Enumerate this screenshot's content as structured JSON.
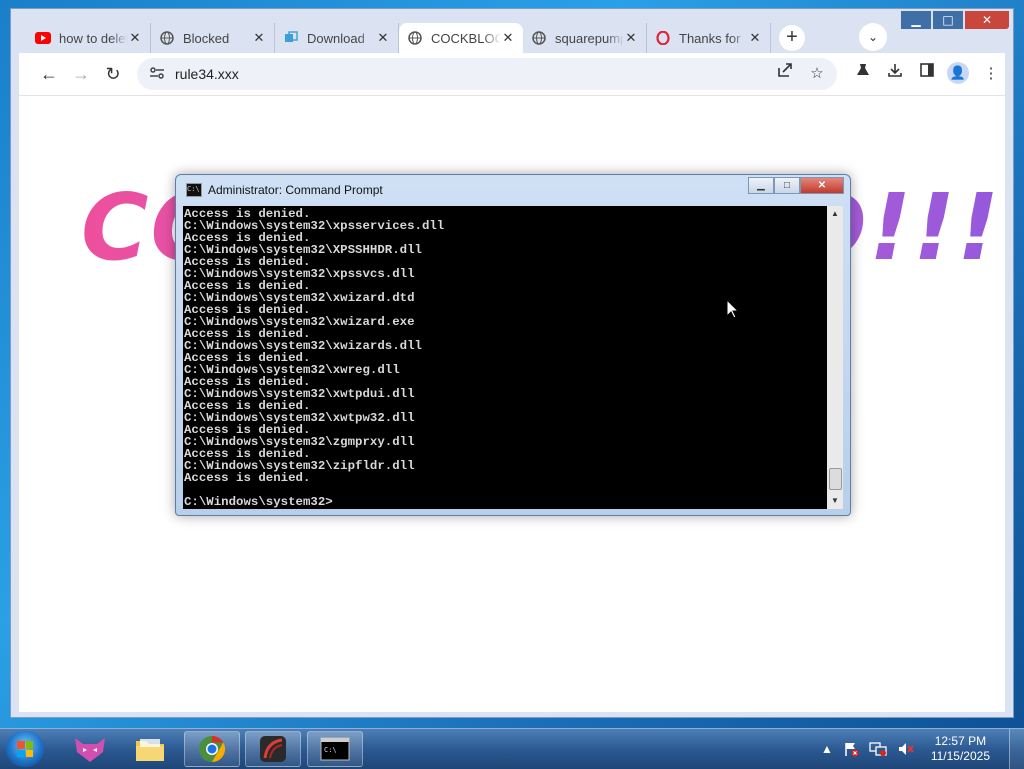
{
  "browser": {
    "tabs": [
      {
        "label": "how to delete",
        "icon": "youtube-icon",
        "active": false
      },
      {
        "label": "Blocked",
        "icon": "globe-icon",
        "active": false
      },
      {
        "label": "Download",
        "icon": "download-site-icon",
        "active": false
      },
      {
        "label": "COCKBLOCKED",
        "icon": "globe-icon",
        "active": true
      },
      {
        "label": "squarepump",
        "icon": "globe-icon",
        "active": false
      },
      {
        "label": "Thanks for",
        "icon": "opera-icon",
        "active": false
      }
    ],
    "address": {
      "url": "rule34.xxx"
    },
    "controls": {
      "back": "←",
      "forward": "→",
      "reload": "↻",
      "new_tab": "+",
      "tab_search": "⌄",
      "minimize": "▁",
      "maximize": "□",
      "close": "✕"
    }
  },
  "page": {
    "headline": "COCKBLOCKED!!!!!"
  },
  "cmd": {
    "title": "Administrator: Command Prompt",
    "icon_text": "C:\\",
    "lines": [
      "Access is denied.",
      "C:\\Windows\\system32\\xpsservices.dll",
      "Access is denied.",
      "C:\\Windows\\system32\\XPSSHHDR.dll",
      "Access is denied.",
      "C:\\Windows\\system32\\xpssvcs.dll",
      "Access is denied.",
      "C:\\Windows\\system32\\xwizard.dtd",
      "Access is denied.",
      "C:\\Windows\\system32\\xwizard.exe",
      "Access is denied.",
      "C:\\Windows\\system32\\xwizards.dll",
      "Access is denied.",
      "C:\\Windows\\system32\\xwreg.dll",
      "Access is denied.",
      "C:\\Windows\\system32\\xwtpdui.dll",
      "Access is denied.",
      "C:\\Windows\\system32\\xwtpw32.dll",
      "Access is denied.",
      "C:\\Windows\\system32\\zgmprxy.dll",
      "Access is denied.",
      "C:\\Windows\\system32\\zipfldr.dll",
      "Access is denied.",
      "",
      "C:\\Windows\\system32>"
    ]
  },
  "taskbar": {
    "apps": [
      {
        "name": "taskbar-app-fox",
        "state": "pinned"
      },
      {
        "name": "taskbar-app-explorer",
        "state": "pinned"
      },
      {
        "name": "taskbar-app-chrome",
        "state": "running"
      },
      {
        "name": "taskbar-app-red-app",
        "state": "running"
      },
      {
        "name": "taskbar-app-cmd",
        "state": "running"
      }
    ],
    "clock": {
      "time": "12:57 PM",
      "date": "11/15/2025"
    }
  }
}
